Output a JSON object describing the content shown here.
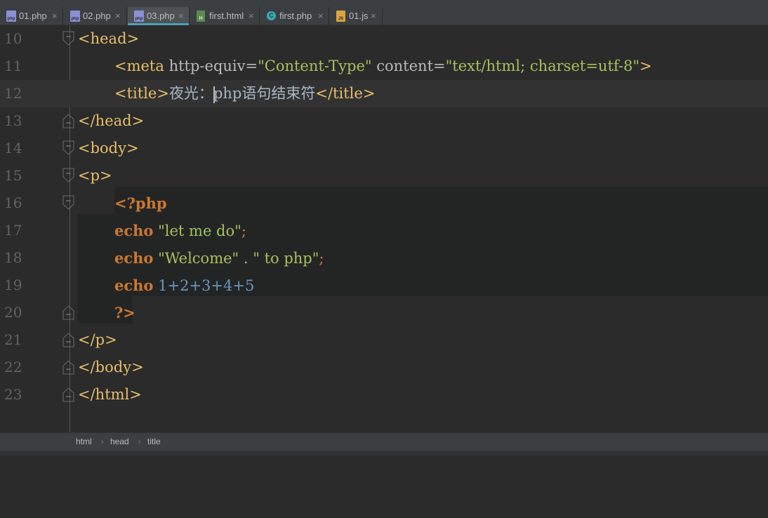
{
  "tabs": [
    {
      "label": "01.php",
      "icon": "php-file-icon",
      "active": false
    },
    {
      "label": "02.php",
      "icon": "php-file-icon",
      "active": false
    },
    {
      "label": "03.php",
      "icon": "php-file-icon",
      "active": true
    },
    {
      "label": "first.html",
      "icon": "html-file-icon",
      "active": false
    },
    {
      "label": "first.php",
      "icon": "php-class-icon",
      "active": false
    },
    {
      "label": "01.js",
      "icon": "js-file-icon",
      "active": false
    }
  ],
  "close_glyph": "×",
  "editor": {
    "line_numbers": [
      "10",
      "11",
      "12",
      "13",
      "14",
      "15",
      "16",
      "17",
      "18",
      "19",
      "20",
      "21",
      "22",
      "23"
    ],
    "lines": {
      "l10": {
        "tag": "<head>"
      },
      "l11": {
        "open": "<meta ",
        "a1": "http-equiv=",
        "v1": "\"Content-Type\"",
        "a2": " content=",
        "v2": "\"text/html; charset=utf-8\"",
        "close": ">"
      },
      "l12": {
        "open": "<title>",
        "text_before_caret": "夜光：",
        "text_after_caret": "php语句结束符",
        "close": "</title>"
      },
      "l13": {
        "tag": "</head>"
      },
      "l14": {
        "tag": "<body>"
      },
      "l15": {
        "tag": "<p>"
      },
      "l16": {
        "php_open": "<?php"
      },
      "l17": {
        "kw": "echo",
        "str": "\"let me do\"",
        "end": ";"
      },
      "l18": {
        "kw": "echo",
        "str1": "\"Welcome\"",
        "op": " . ",
        "str2": "\" to php\"",
        "end": ";"
      },
      "l19": {
        "kw": "echo",
        "expr": "1+2+3+4+5"
      },
      "l20": {
        "php_close": "?>"
      },
      "l21": {
        "tag": "</p>"
      },
      "l22": {
        "tag": "</body>"
      },
      "l23": {
        "tag": "</html>"
      }
    }
  },
  "breadcrumbs": [
    "html",
    "head",
    "title"
  ],
  "breadcrumb_sep": "›",
  "colors": {
    "background": "#2b2b2b",
    "tag": "#e8bf6a",
    "string": "#a5c25c",
    "keyword": "#cc7832",
    "number": "#6897bb",
    "tab_active_underline": "#4a9eb4"
  }
}
